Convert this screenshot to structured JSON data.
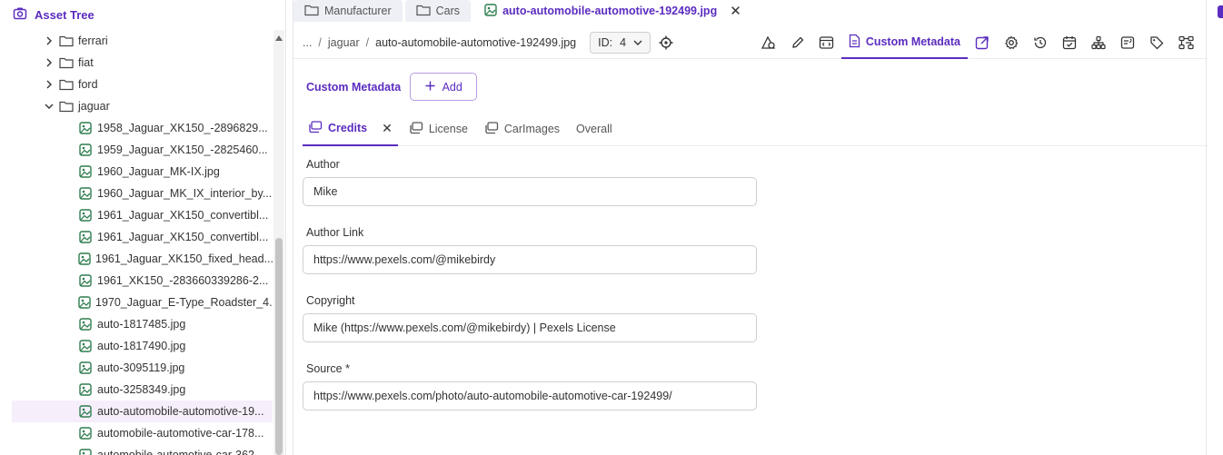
{
  "left_panel": {
    "title": "Asset Tree",
    "folders": [
      {
        "label": "ferrari",
        "expanded": false
      },
      {
        "label": "fiat",
        "expanded": false
      },
      {
        "label": "ford",
        "expanded": false
      },
      {
        "label": "jaguar",
        "expanded": true
      }
    ],
    "files": [
      "1958_Jaguar_XK150_-2896829...",
      "1959_Jaguar_XK150_-2825460...",
      "1960_Jaguar_MK-IX.jpg",
      "1960_Jaguar_MK_IX_interior_by...",
      "1961_Jaguar_XK150_convertibl...",
      "1961_Jaguar_XK150_convertibl...",
      "1961_Jaguar_XK150_fixed_head...",
      "1961_XK150_-283660339286-2...",
      "1970_Jaguar_E-Type_Roadster_4...",
      "auto-1817485.jpg",
      "auto-1817490.jpg",
      "auto-3095119.jpg",
      "auto-3258349.jpg",
      "auto-automobile-automotive-19...",
      "automobile-automotive-car-178...",
      "automobile-automotive-car-362..."
    ],
    "selected_file_index": 13
  },
  "tabs": [
    {
      "label": "Manufacturer",
      "icon": "folder-icon"
    },
    {
      "label": "Cars",
      "icon": "folder-icon"
    },
    {
      "label": "auto-automobile-automotive-192499.jpg",
      "icon": "image-icon",
      "active": true
    }
  ],
  "breadcrumb": {
    "ellipsis": "...",
    "sep": "/",
    "folder": "jaguar",
    "file": "auto-automobile-automotive-192499.jpg"
  },
  "id_select": {
    "label": "ID:",
    "value": "4"
  },
  "toolbar": {
    "custom_metadata_label": "Custom Metadata",
    "tool_icons": [
      "shape-icon",
      "pencil-icon",
      "embed-icon",
      "custom-metadata-icon",
      "open-external-icon",
      "gear-icon",
      "history-icon",
      "schedule-icon",
      "hierarchy-icon",
      "notes-icon",
      "tag-icon",
      "workflow-icon"
    ]
  },
  "custom_metadata": {
    "label": "Custom Metadata",
    "add_label": "Add"
  },
  "subtabs": [
    {
      "label": "Credits",
      "active": true,
      "closable": true
    },
    {
      "label": "License"
    },
    {
      "label": "CarImages"
    },
    {
      "label": "Overall"
    }
  ],
  "fields": [
    {
      "label": "Author",
      "value": "Mike"
    },
    {
      "label": "Author Link",
      "value": "https://www.pexels.com/@mikebirdy"
    },
    {
      "label": "Copyright",
      "value": "Mike (https://www.pexels.com/@mikebirdy) | Pexels License"
    },
    {
      "label": "Source *",
      "value": "https://www.pexels.com/photo/auto-automobile-automotive-car-192499/"
    }
  ],
  "colors": {
    "accent": "#5b2cc0",
    "selected_row": "#f6eefb",
    "icon_green": "#2e7d4f"
  }
}
